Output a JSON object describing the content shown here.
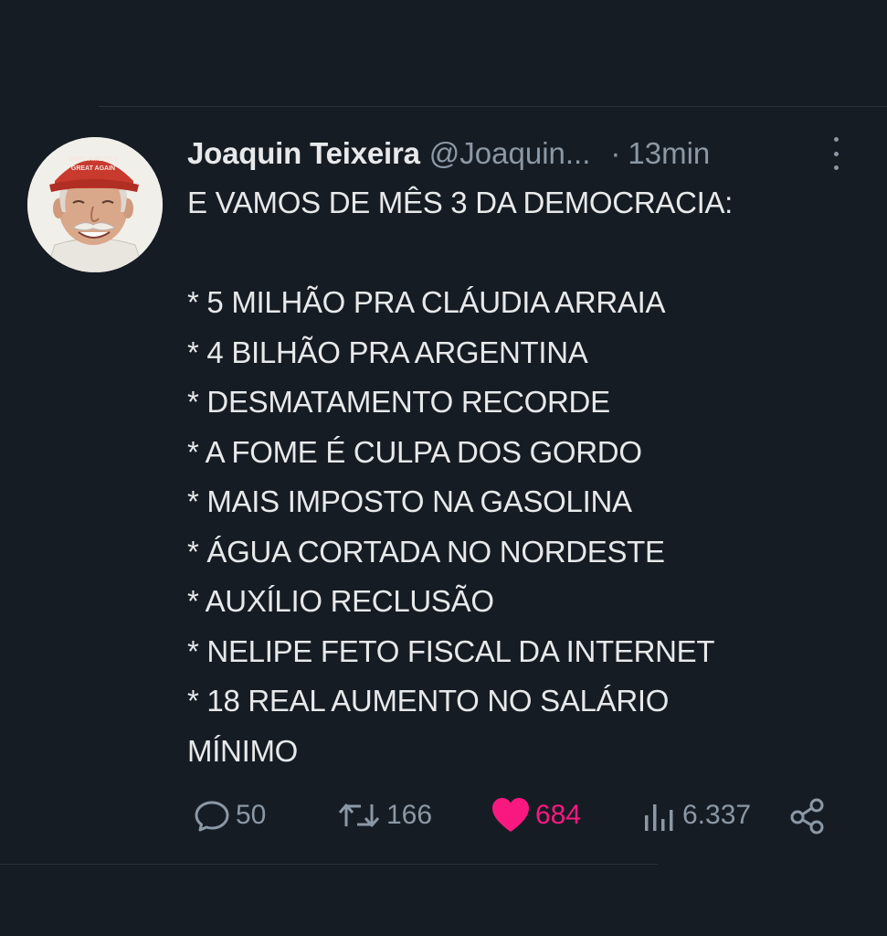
{
  "tweet": {
    "author": {
      "display_name": "Joaquin Teixeira",
      "handle": "@Joaquin...",
      "avatar_icon": "user-avatar-red-cap"
    },
    "separator": "·",
    "timestamp": "13min",
    "lines": [
      "E VAMOS DE MÊS 3 DA DEMOCRACIA:",
      "",
      "* 5 MILHÃO PRA CLÁUDIA ARRAIA",
      "* 4 BILHÃO PRA ARGENTINA",
      "* DESMATAMENTO RECORDE",
      "* A FOME É CULPA DOS GORDO",
      "* MAIS IMPOSTO NA GASOLINA",
      "* ÁGUA CORTADA NO NORDESTE",
      "* AUXÍLIO RECLUSÃO",
      "* NELIPE FETO FISCAL DA INTERNET",
      "* 18 REAL AUMENTO NO SALÁRIO",
      "MÍNIMO"
    ],
    "actions": {
      "replies": "50",
      "retweets": "166",
      "likes": "684",
      "views": "6.337"
    }
  },
  "icons": {
    "reply": "speech-bubble-icon",
    "retweet": "retweet-arrows-icon",
    "like": "heart-icon",
    "views": "bar-chart-icon",
    "share": "share-nodes-icon",
    "more": "vertical-ellipsis-icon"
  },
  "colors": {
    "background": "#161c24",
    "text_primary": "#e7e9ea",
    "text_secondary": "#8b98a5",
    "like_active": "#f91880"
  }
}
